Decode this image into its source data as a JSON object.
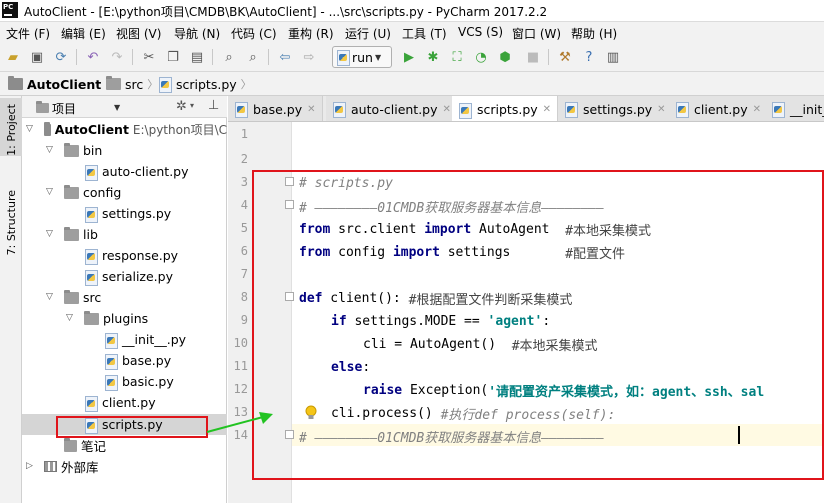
{
  "window": {
    "title": "AutoClient - [E:\\python项目\\CMDB\\BK\\AutoClient] - ...\\src\\scripts.py - PyCharm 2017.2.2",
    "app_icon_label": "PC"
  },
  "menubar": {
    "items": [
      "文件 (F)",
      "编辑 (E)",
      "视图 (V)",
      "导航 (N)",
      "代码 (C)",
      "重构 (R)",
      "运行 (U)",
      "工具 (T)",
      "VCS (S)",
      "窗口 (W)",
      "帮助 (H)"
    ]
  },
  "toolbar": {
    "run_config": "run"
  },
  "breadcrumb": {
    "items": [
      "AutoClient",
      "src",
      "scripts.py"
    ]
  },
  "sidebar": {
    "project_tab": "1: Project",
    "structure_tab": "7: Structure",
    "header_label": "项目"
  },
  "tree": {
    "root": "AutoClient",
    "root_path": "E:\\python项目\\C",
    "items": [
      "bin",
      "auto-client.py",
      "config",
      "settings.py",
      "lib",
      "response.py",
      "serialize.py",
      "src",
      "plugins",
      "__init__.py",
      "base.py",
      "basic.py",
      "client.py",
      "scripts.py",
      "笔记",
      "外部库"
    ]
  },
  "tabs": [
    "base.py",
    "auto-client.py",
    "scripts.py",
    "settings.py",
    "client.py",
    "__init_"
  ],
  "editor": {
    "line_numbers": [
      "1",
      "2",
      "3",
      "4",
      "5",
      "6",
      "7",
      "8",
      "9",
      "10",
      "11",
      "12",
      "13",
      "14"
    ],
    "lines": {
      "l3": "# scripts.py",
      "l4": "# ————————01CMDB获取服务器基本信息————————",
      "l5_kw1": "from",
      "l5_mod": " src.client ",
      "l5_kw2": "import",
      "l5_name": " AutoAgent  ",
      "l5_cm": "#本地采集模式",
      "l6_kw1": "from",
      "l6_mod": " config ",
      "l6_kw2": "import",
      "l6_name": " settings       ",
      "l6_cm": "#配置文件",
      "l8_kw": "def",
      "l8_rest": " client(): ",
      "l8_cm": "#根据配置文件判断采集模式",
      "l9_kw": "if",
      "l9_rest": " settings.MODE == ",
      "l9_str": "'agent'",
      "l9_end": ":",
      "l10_rest": "cli = AutoAgent()  ",
      "l10_cm": "#本地采集模式",
      "l11_kw": "else",
      "l11_end": ":",
      "l12_kw": "raise",
      "l12_rest": " Exception(",
      "l12_str": "'请配置资产采集模式，如：agent、ssh、sal",
      "l13_rest": "cli.process() ",
      "l13_cm": "#执行def process(self):",
      "l14": "# ————————01CMDB获取服务器基本信息————————"
    }
  },
  "colors": {
    "annotation_red": "#e0141b",
    "annotation_green": "#22c322",
    "keyword": "#000080",
    "string": "#008080",
    "comment": "#808080"
  }
}
